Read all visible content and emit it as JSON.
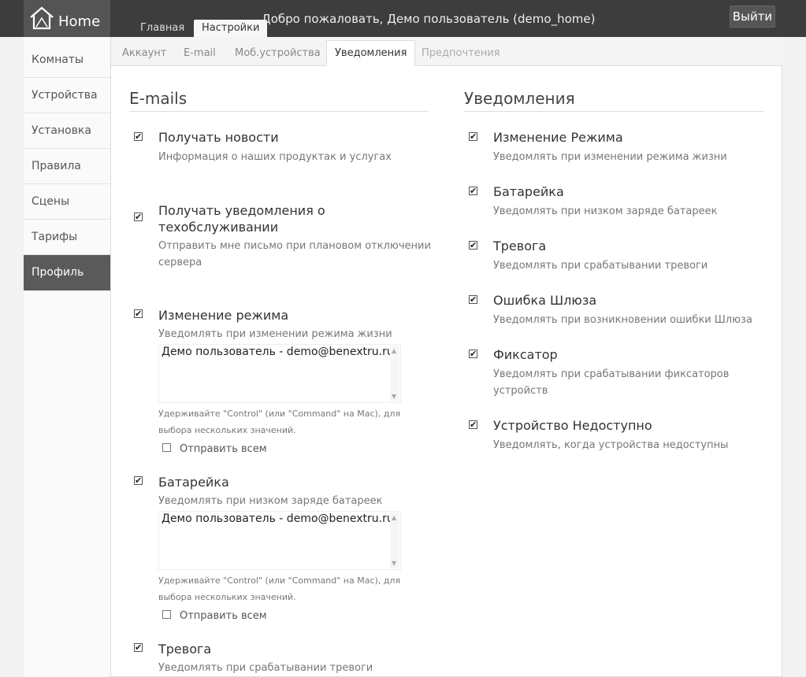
{
  "header": {
    "logo_text": "Home",
    "tabs": [
      "Главная",
      "Настройки"
    ],
    "welcome": "Добро пожаловать, Демо пользователь (demo_home)",
    "logout": "Выйти"
  },
  "sidebar": {
    "items": [
      "Комнаты",
      "Устройства",
      "Установка",
      "Правила",
      "Сцены",
      "Тарифы",
      "Профиль"
    ],
    "active": "Профиль"
  },
  "subtabs": [
    "Аккаунт",
    "E-mail",
    "Моб.устройства",
    "Уведомления",
    "Предпочтения"
  ],
  "emails": {
    "title": "E-mails",
    "items": [
      {
        "title": "Получать новости",
        "desc": "Информация о наших продуктак и услугах",
        "checked": true
      },
      {
        "title": "Получать уведомления о техобслуживании",
        "desc": "Отправить мне письмо при плановом отключении сервера",
        "checked": true
      },
      {
        "title": "Изменение режима",
        "desc": "Уведомлять при изменении режима жизни",
        "checked": true,
        "select_value": "Демо пользователь - demo@benextru.ru",
        "hint": "Удерживайте \"Control\" (или \"Command\" на Mac), для выбора нескольких значений.",
        "send_all": "Отправить всем"
      },
      {
        "title": "Батарейка",
        "desc": "Уведомлять при низком заряде батареек",
        "checked": true,
        "select_value": "Демо пользователь - demo@benextru.ru",
        "hint": "Удерживайте \"Control\" (или \"Command\" на Mac), для выбора нескольких значений.",
        "send_all": "Отправить всем"
      },
      {
        "title": "Тревога",
        "desc": "Уведомлять при срабатывании тревоги",
        "checked": true
      }
    ]
  },
  "notifications": {
    "title": "Уведомления",
    "items": [
      {
        "title": "Изменение Режима",
        "desc": "Уведомлять при изменении режима жизни",
        "checked": true
      },
      {
        "title": "Батарейка",
        "desc": "Уведомлять при низком заряде батареек",
        "checked": true
      },
      {
        "title": "Тревога",
        "desc": "Уведомлять при срабатывании тревоги",
        "checked": true
      },
      {
        "title": "Ошибка Шлюза",
        "desc": "Уведомлять при возникновении ошибки Шлюза",
        "checked": true
      },
      {
        "title": "Фиксатор",
        "desc": "Уведомлять при срабатывании фиксаторов устройств",
        "checked": true
      },
      {
        "title": "Устройство Недоступно",
        "desc": "Уведомлять, когда устройства недоступны",
        "checked": true
      }
    ]
  },
  "icons": {
    "logo": "house-icon",
    "checkbox_mark": "✔"
  }
}
